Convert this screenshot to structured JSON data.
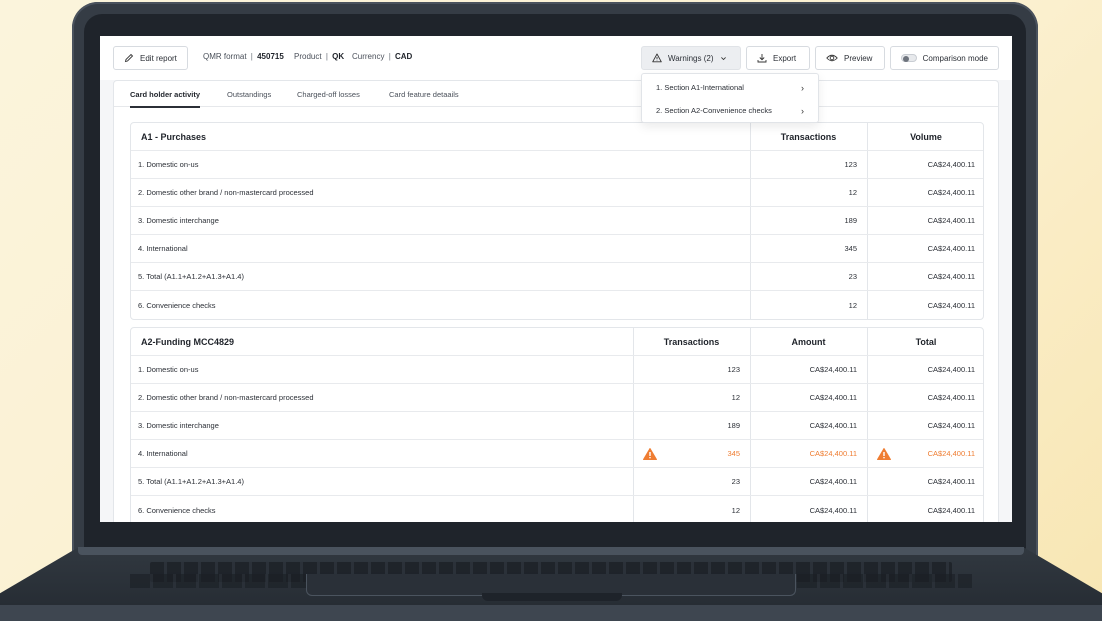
{
  "toolbar": {
    "edit_label": "Edit report",
    "qmr_label": "QMR format",
    "qmr_value": "450715",
    "product_label": "Product",
    "product_value": "QK",
    "currency_label": "Currency",
    "currency_value": "CAD",
    "separator": "|",
    "warnings_label": "Warnings (2)",
    "export_label": "Export",
    "preview_label": "Preview",
    "comparison_label": "Comparison mode"
  },
  "warnings_dropdown": {
    "items": [
      {
        "label": "1. Section A1-International"
      },
      {
        "label": "2. Section A2-Convenience checks"
      }
    ]
  },
  "tabs": [
    {
      "label": "Card holder activity",
      "active": true
    },
    {
      "label": "Outstandings",
      "active": false
    },
    {
      "label": "Charged-off losses",
      "active": false
    },
    {
      "label": "Card feature detaails",
      "active": false
    }
  ],
  "table_a1": {
    "title": "A1 - Purchases",
    "columns": [
      "Transactions",
      "Volume"
    ],
    "rows": [
      {
        "label": "1. Domestic on-us",
        "transactions": "123",
        "volume": "CA$24,400.11"
      },
      {
        "label": "2. Domestic other brand / non-mastercard processed",
        "transactions": "12",
        "volume": "CA$24,400.11"
      },
      {
        "label": "3. Domestic interchange",
        "transactions": "189",
        "volume": "CA$24,400.11"
      },
      {
        "label": "4. International",
        "transactions": "345",
        "volume": "CA$24,400.11"
      },
      {
        "label": "5. Total (A1.1+A1.2+A1.3+A1.4)",
        "transactions": "23",
        "volume": "CA$24,400.11"
      },
      {
        "label": "6. Convenience checks",
        "transactions": "12",
        "volume": "CA$24,400.11"
      }
    ]
  },
  "table_a2": {
    "title": "A2-Funding MCC4829",
    "columns": [
      "Transactions",
      "Amount",
      "Total"
    ],
    "rows": [
      {
        "label": "1. Domestic on-us",
        "transactions": "123",
        "amount": "CA$24,400.11",
        "total": "CA$24,400.11"
      },
      {
        "label": "2. Domestic other brand / non-mastercard processed",
        "transactions": "12",
        "amount": "CA$24,400.11",
        "total": "CA$24,400.11"
      },
      {
        "label": "3. Domestic interchange",
        "transactions": "189",
        "amount": "CA$24,400.11",
        "total": "CA$24,400.11"
      },
      {
        "label": "4. International",
        "transactions": "345",
        "amount": "CA$24,400.11",
        "total": "CA$24,400.11",
        "warning": true
      },
      {
        "label": "5. Total (A1.1+A1.2+A1.3+A1.4)",
        "transactions": "23",
        "amount": "CA$24,400.11",
        "total": "CA$24,400.11"
      },
      {
        "label": "6. Convenience checks",
        "transactions": "12",
        "amount": "CA$24,400.11",
        "total": "CA$24,400.11"
      }
    ]
  },
  "colors": {
    "warning": "#ef7d32",
    "background": "#fbf2d6",
    "laptop": "#353c45"
  },
  "icons": {
    "edit": "pencil-icon",
    "warnings": "warning-triangle-icon",
    "export": "download-icon",
    "preview": "eye-icon",
    "comparison": "toggle-switch",
    "row_warning": "warning-triangle-filled-icon"
  }
}
